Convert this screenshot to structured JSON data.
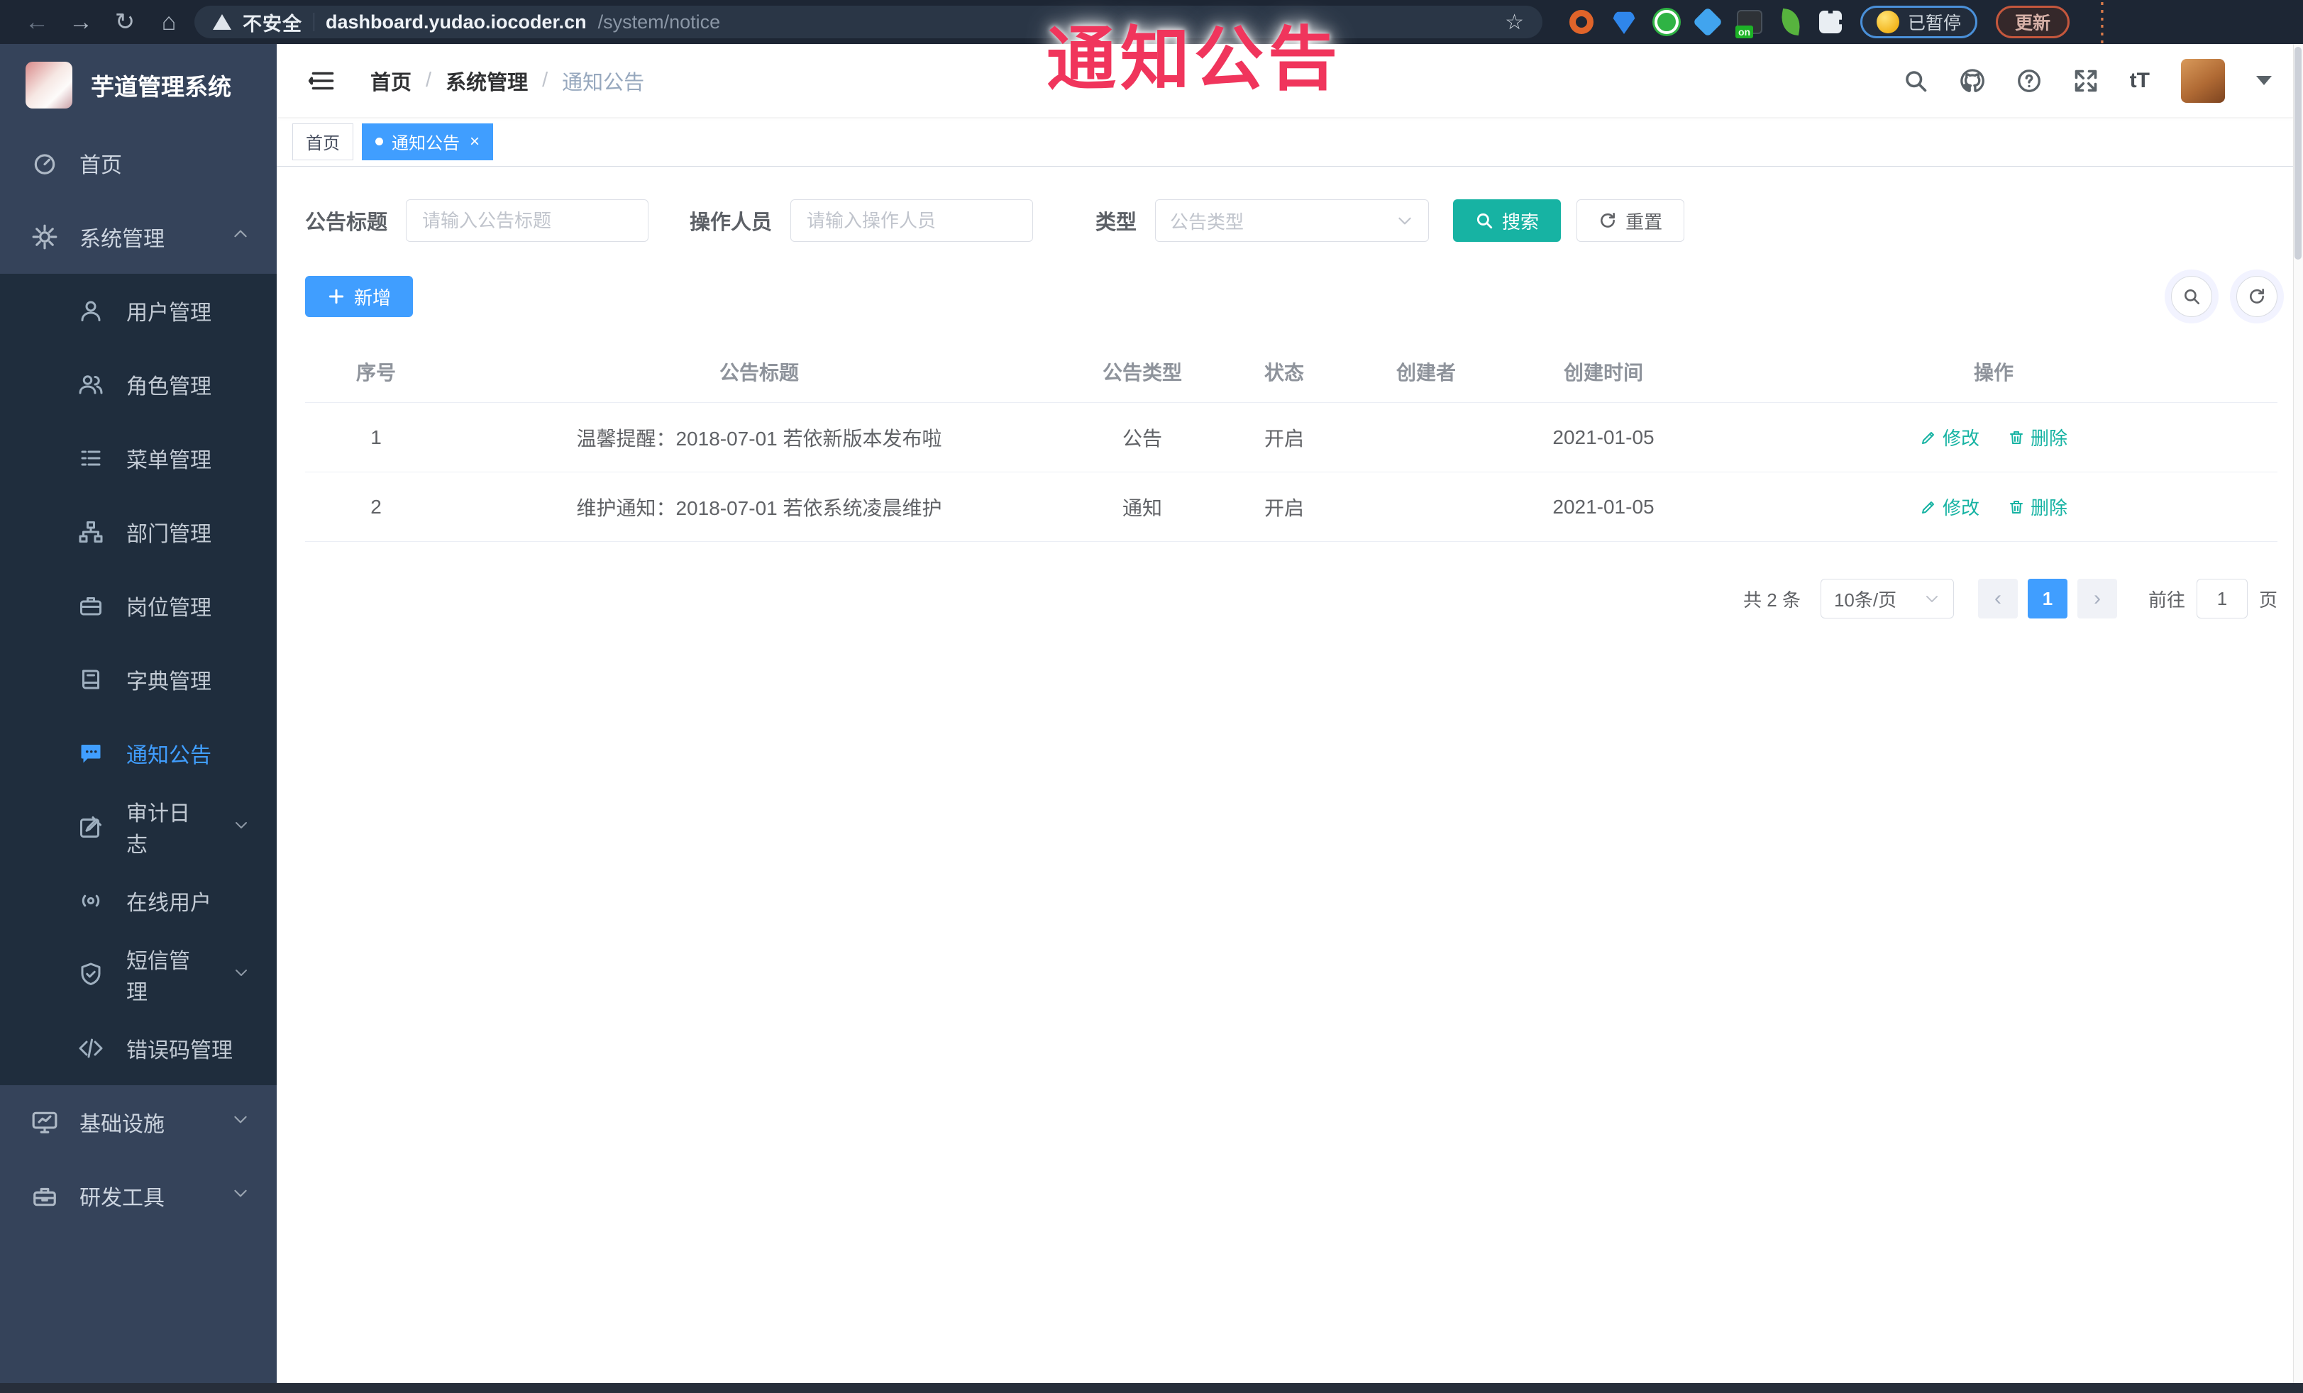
{
  "watermark": {
    "text": "通知公告"
  },
  "browser": {
    "security_warning": "不安全",
    "url_host": "dashboard.yudao.iocoder.cn",
    "url_path": "/system/notice",
    "profile_status": "已暂停",
    "update_label": "更新",
    "extension_badge": "on"
  },
  "sidebar": {
    "app_title": "芋道管理系统",
    "home_label": "首页",
    "system_label": "系统管理",
    "system_submenu": [
      {
        "label": "用户管理"
      },
      {
        "label": "角色管理"
      },
      {
        "label": "菜单管理"
      },
      {
        "label": "部门管理"
      },
      {
        "label": "岗位管理"
      },
      {
        "label": "字典管理"
      },
      {
        "label": "通知公告"
      },
      {
        "label": "审计日志"
      },
      {
        "label": "在线用户"
      },
      {
        "label": "短信管理"
      },
      {
        "label": "错误码管理"
      }
    ],
    "infra_label": "基础设施",
    "devtool_label": "研发工具"
  },
  "header": {
    "breadcrumb": [
      "首页",
      "系统管理",
      "通知公告"
    ],
    "font_size_icon_text": "tT"
  },
  "tabs": [
    {
      "label": "首页"
    },
    {
      "label": "通知公告"
    }
  ],
  "filters": {
    "title_label": "公告标题",
    "title_placeholder": "请输入公告标题",
    "operator_label": "操作人员",
    "operator_placeholder": "请输入操作人员",
    "type_label": "类型",
    "type_placeholder": "公告类型",
    "search_label": "搜索",
    "reset_label": "重置"
  },
  "toolbar": {
    "add_label": "新增"
  },
  "table": {
    "columns": [
      "序号",
      "公告标题",
      "公告类型",
      "状态",
      "创建者",
      "创建时间",
      "操作"
    ],
    "rows": [
      {
        "no": "1",
        "title": "温馨提醒：2018-07-01 若依新版本发布啦",
        "type": "公告",
        "status": "开启",
        "creator": "",
        "created": "2021-01-05",
        "edit": "修改",
        "delete": "删除"
      },
      {
        "no": "2",
        "title": "维护通知：2018-07-01 若依系统凌晨维护",
        "type": "通知",
        "status": "开启",
        "creator": "",
        "created": "2021-01-05",
        "edit": "修改",
        "delete": "删除"
      }
    ]
  },
  "pagination": {
    "total": "共 2 条",
    "page_size": "10条/页",
    "current_page": "1",
    "goto_label": "前往",
    "goto_value": "1",
    "goto_unit": "页"
  },
  "colors": {
    "primary": "#409EFF",
    "teal": "#17B3A3",
    "sidebar_bg": "#35435a",
    "submenu_bg": "#1f2d3d",
    "watermark_red": "#f0355c",
    "chrome_bg": "#1d2634"
  }
}
